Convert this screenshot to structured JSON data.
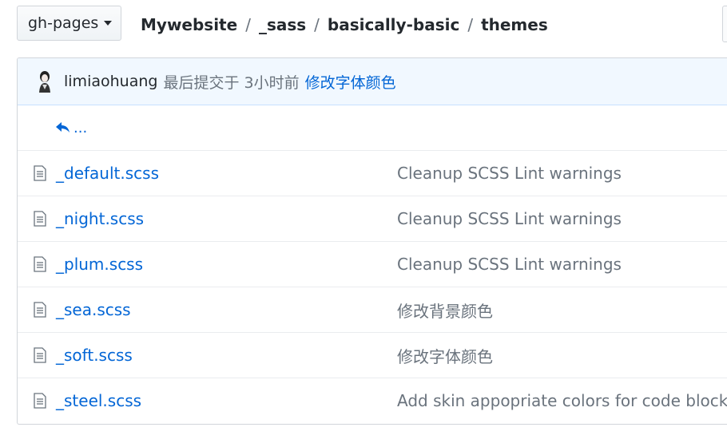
{
  "branch": {
    "label": "gh-pages"
  },
  "breadcrumb": {
    "root": "Mywebsite",
    "parts": [
      "_sass",
      "basically-basic",
      "themes"
    ],
    "separator": "/"
  },
  "commit": {
    "author": "limiaohuang",
    "meta": "最后提交于 3小时前",
    "message": "修改字体颜色"
  },
  "up_link": {
    "label": "..."
  },
  "files": [
    {
      "name": "_default.scss",
      "message": "Cleanup SCSS Lint warnings",
      "icon": "file-icon"
    },
    {
      "name": "_night.scss",
      "message": "Cleanup SCSS Lint warnings",
      "icon": "file-icon"
    },
    {
      "name": "_plum.scss",
      "message": "Cleanup SCSS Lint warnings",
      "icon": "file-icon"
    },
    {
      "name": "_sea.scss",
      "message": "修改背景颜色",
      "icon": "file-icon"
    },
    {
      "name": "_soft.scss",
      "message": "修改字体颜色",
      "icon": "file-icon"
    },
    {
      "name": "_steel.scss",
      "message": "Add skin appopriate colors for code blocks",
      "icon": "file-icon"
    }
  ],
  "colors": {
    "link": "#0366d6",
    "muted": "#6a737d",
    "commit_bg": "#f1f8ff",
    "border": "#d1d5da"
  }
}
